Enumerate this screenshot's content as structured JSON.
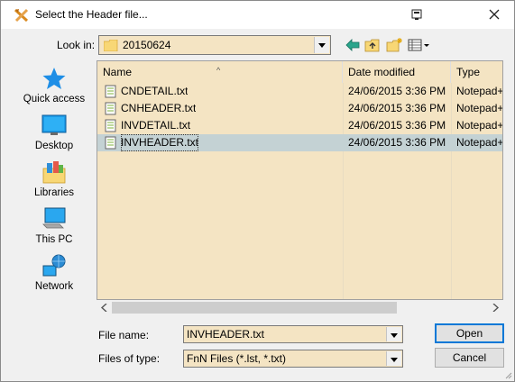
{
  "window": {
    "title": "Select the Header file..."
  },
  "toolbar": {
    "look_in_label": "Look in:",
    "look_in_value": "20150624"
  },
  "places": [
    {
      "label": "Quick access",
      "icon": "quick-access-icon"
    },
    {
      "label": "Desktop",
      "icon": "desktop-icon"
    },
    {
      "label": "Libraries",
      "icon": "libraries-icon"
    },
    {
      "label": "This PC",
      "icon": "this-pc-icon"
    },
    {
      "label": "Network",
      "icon": "network-icon"
    }
  ],
  "file_list": {
    "columns": [
      "Name",
      "Date modified",
      "Type"
    ],
    "rows": [
      {
        "name": "CNDETAIL.txt",
        "date": "24/06/2015 3:36 PM",
        "type": "Notepad++ Document"
      },
      {
        "name": "CNHEADER.txt",
        "date": "24/06/2015 3:36 PM",
        "type": "Notepad++ Document"
      },
      {
        "name": "INVDETAIL.txt",
        "date": "24/06/2015 3:36 PM",
        "type": "Notepad++ Document"
      },
      {
        "name": "INVHEADER.txt",
        "date": "24/06/2015 3:36 PM",
        "type": "Notepad++ Document"
      }
    ],
    "selected_index": 3
  },
  "bottom": {
    "file_name_label": "File name:",
    "file_name_value": "INVHEADER.txt",
    "file_type_label": "Files of type:",
    "file_type_value": "FnN Files (*.lst, *.txt)",
    "open_label": "Open",
    "cancel_label": "Cancel"
  },
  "colors": {
    "field_bg": "#f4e4c3",
    "selection_bg": "#c4d2d4",
    "default_button_border": "#0078d7"
  }
}
